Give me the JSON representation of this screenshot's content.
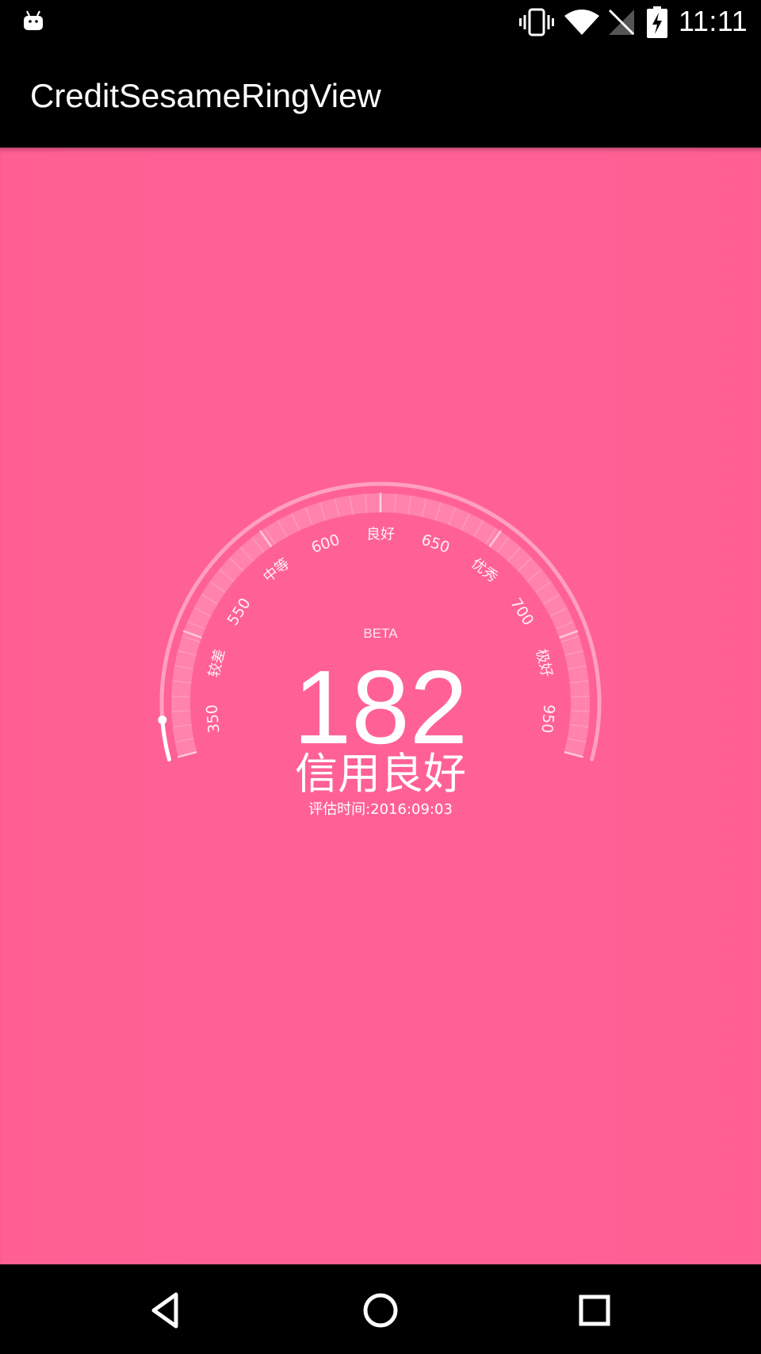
{
  "status_bar": {
    "time": "11:11",
    "icons": [
      "android-notification-icon",
      "vibrate-icon",
      "wifi-icon",
      "signal-off-icon",
      "battery-charging-icon"
    ]
  },
  "app_bar": {
    "title": "CreditSesameRingView"
  },
  "gauge": {
    "beta_label": "BETA",
    "score": "182",
    "level_label": "信用良好",
    "date_label": "评估时间:2016:09:03",
    "scale_labels": [
      "350",
      "较差",
      "550",
      "中等",
      "600",
      "良好",
      "650",
      "优秀",
      "700",
      "极好",
      "950"
    ],
    "progress_fraction": 0.05,
    "colors": {
      "background": "#ff6196",
      "ring": "#ffffff"
    }
  },
  "nav_bar": {
    "icons": [
      "back-icon",
      "home-icon",
      "recents-icon"
    ]
  }
}
